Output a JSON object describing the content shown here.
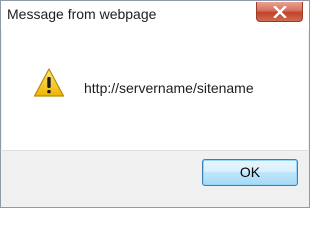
{
  "dialog": {
    "title": "Message from webpage",
    "message": "http://servername/sitename",
    "icon": "warning-icon",
    "ok_label": "OK",
    "close_icon": "close-icon"
  },
  "colors": {
    "close_button": "#c7432a",
    "ok_button_border": "#3c7fb1",
    "warning_fill": "#f5c400"
  }
}
